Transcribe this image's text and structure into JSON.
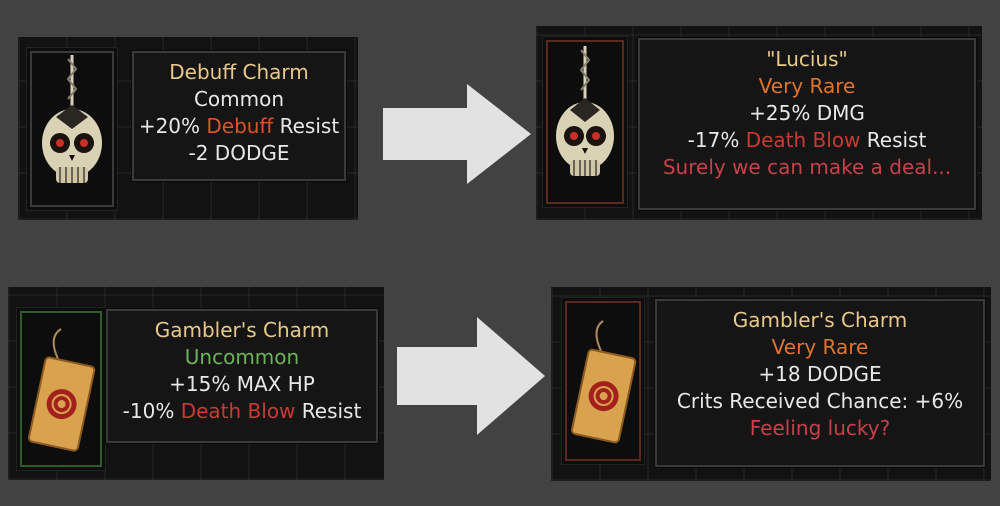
{
  "colors": {
    "title": "#e8c98a",
    "common": "#e8e8e8",
    "uncommon": "#6db35a",
    "very_rare": "#e0742c",
    "keyword": "#d9552b",
    "keyword_red": "#c93a33",
    "flavor": "#c8404a",
    "text": "#e8e8e8",
    "arrow": "#e2e2e2"
  },
  "before_top": {
    "icon": "skull-charm-icon",
    "title": "Debuff Charm",
    "rarity": "Common",
    "stat1": {
      "prefix": "+20% ",
      "keyword": "Debuff",
      "suffix": " Resist"
    },
    "stat2": "-2 DODGE"
  },
  "after_top": {
    "icon": "skull-charm-icon",
    "title": "\"Lucius\"",
    "rarity": "Very Rare",
    "stat1": "+25% DMG",
    "stat2": {
      "prefix": "-17% ",
      "keyword": "Death Blow",
      "suffix": " Resist"
    },
    "flavor": "Surely we can make a deal..."
  },
  "before_bottom": {
    "icon": "gambler-card-icon",
    "title": "Gambler's Charm",
    "rarity": "Uncommon",
    "stat1": "+15% MAX HP",
    "stat2": {
      "prefix": "-10% ",
      "keyword": "Death Blow",
      "suffix": " Resist"
    }
  },
  "after_bottom": {
    "icon": "gambler-card-icon",
    "title": "Gambler's Charm",
    "rarity": "Very Rare",
    "stat1": "+18 DODGE",
    "stat2": "Crits Received Chance: +6%",
    "flavor": "Feeling lucky?"
  }
}
